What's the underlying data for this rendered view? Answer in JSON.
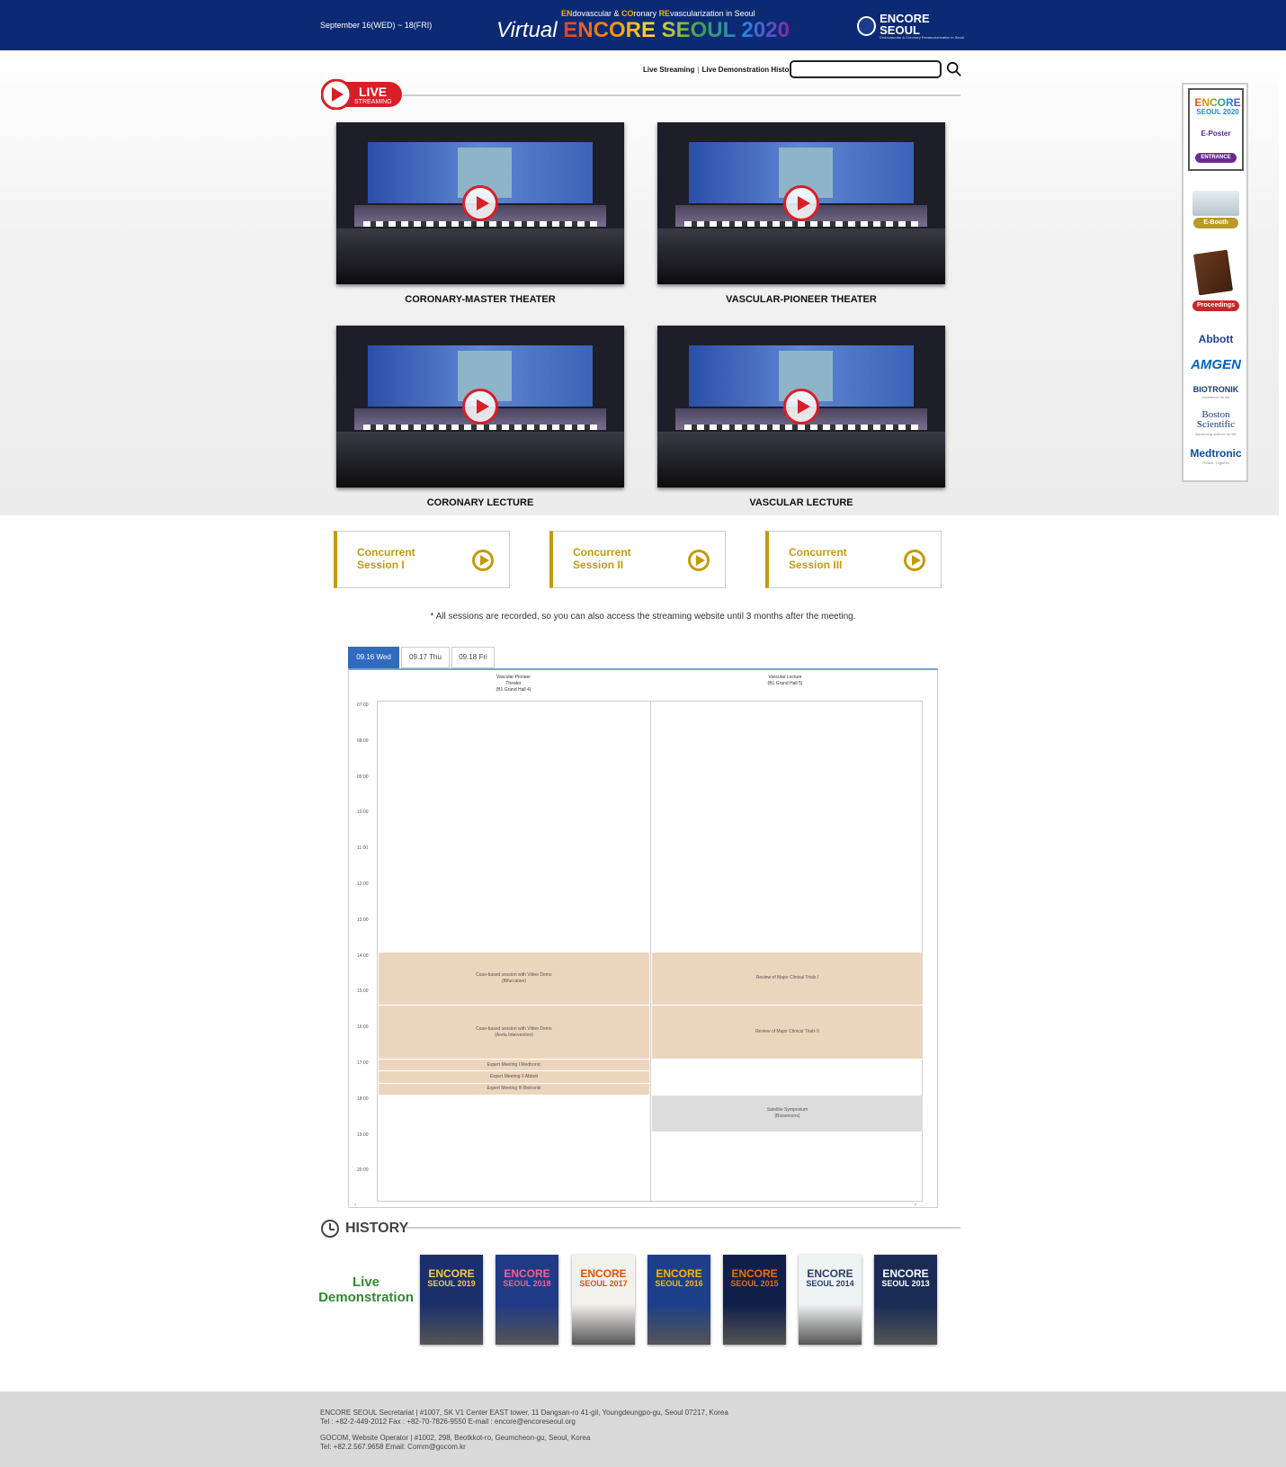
{
  "header": {
    "date": "September 16(WED) ~ 18(FRI)",
    "tag_en": "EN",
    "tag_1": "dovascular & ",
    "tag_co": "CO",
    "tag_2": "ronary ",
    "tag_re": "RE",
    "tag_3": "vascularization in Seoul",
    "title_virtual": "Virtual",
    "title_main": "ENCORE SEOUL 2020",
    "logo_text": "ENCORE SEOUL",
    "logo_sub": "Endovascular & Coronary Revascularization in Seoul"
  },
  "nav": {
    "live_streaming": "Live Streaming",
    "separator": "|",
    "live_demo_history": "Live Demonstration History",
    "search_placeholder": ""
  },
  "live_badge": {
    "live": "LIVE",
    "streaming": "STREAMING"
  },
  "theaters": [
    {
      "label": "CORONARY-MASTER THEATER"
    },
    {
      "label": "VASCULAR-PIONEER THEATER"
    },
    {
      "label": "CORONARY LECTURE"
    },
    {
      "label": "VASCULAR LECTURE"
    }
  ],
  "sidebar": {
    "encore": "ENCORE",
    "seoul2020": "SEOUL 2020",
    "eposter": "E-Poster",
    "entrance": "ENTRANCE",
    "ebooth": "E-Booth",
    "proceedings": "Proceedings",
    "sponsors": [
      {
        "name": "Abbott",
        "sub": "",
        "color": "#1f3f8f"
      },
      {
        "name": "AMGEN",
        "sub": "",
        "color": "#0063c3"
      },
      {
        "name": "BIOTRONIK",
        "sub": "excellence for life",
        "color": "#1a3a7a"
      },
      {
        "name": "Boston Scientific",
        "sub": "Advancing science for life",
        "color": "#1a3a7a"
      },
      {
        "name": "Medtronic",
        "sub": "Further, Together",
        "color": "#0a4fa3"
      }
    ]
  },
  "sessions": [
    {
      "line1": "Concurrent",
      "line2": "Session I"
    },
    {
      "line1": "Concurrent",
      "line2": "Session II"
    },
    {
      "line1": "Concurrent",
      "line2": "Session III"
    }
  ],
  "notice": "* All sessions are recorded, so you can also access the streaming website until 3 months after the meeting.",
  "schedule": {
    "tabs": [
      "09.16 Wed",
      "09.17 Thu",
      "09.18 Fri"
    ],
    "active_tab": "09.16 Wed",
    "columns": [
      {
        "line1": "Vascular-Pioneer",
        "line2": "Theater",
        "line3": "(B1 Grand Hall 4)"
      },
      {
        "line1": "Vascular Lecture",
        "line2": "(B1 Grand Hall 5)",
        "line3": ""
      }
    ],
    "times": [
      "07:00",
      "08:00",
      "09:00",
      "10:00",
      "11:00",
      "12:00",
      "13:00",
      "14:00",
      "15:00",
      "16:00",
      "17:00",
      "18:00",
      "19:00",
      "20:00"
    ],
    "events": [
      {
        "col": 0,
        "start": 14.0,
        "end": 15.5,
        "line1": "Case-based session with Video Demo",
        "line2": "(Bifurcation)",
        "style": "peach"
      },
      {
        "col": 0,
        "start": 15.5,
        "end": 17.0,
        "line1": "Case-based session with Video Demo",
        "line2": "(Aorta Intervention)",
        "style": "peach"
      },
      {
        "col": 0,
        "start": 17.0,
        "end": 17.33,
        "line1": "Expert Meeting I Medtronic",
        "line2": "",
        "style": "peach"
      },
      {
        "col": 0,
        "start": 17.33,
        "end": 17.67,
        "line1": "Expert Meeting II Abbott",
        "line2": "",
        "style": "peach"
      },
      {
        "col": 0,
        "start": 17.67,
        "end": 18.0,
        "line1": "Expert Meeting III Biotronik",
        "line2": "",
        "style": "peach"
      },
      {
        "col": 1,
        "start": 14.0,
        "end": 15.5,
        "line1": "Review of Major Clinical Trials I",
        "line2": "",
        "style": "peach"
      },
      {
        "col": 1,
        "start": 15.5,
        "end": 17.0,
        "line1": "Review of Major Clinical Trials II",
        "line2": "",
        "style": "peach"
      },
      {
        "col": 1,
        "start": 18.0,
        "end": 19.0,
        "line1": "Satellite Symposium",
        "line2": "(Biosensors)",
        "style": "grey"
      }
    ],
    "scroll_left": "‹",
    "scroll_right": "›"
  },
  "history": {
    "title": "HISTORY",
    "live_demo_1": "Live",
    "live_demo_2": "Demonstration",
    "posters": [
      {
        "encore": "ENCORE",
        "year": "SEOUL 2019",
        "bg": "#1b2f6b",
        "fg": "#f7c948"
      },
      {
        "encore": "ENCORE",
        "year": "SEOUL 2018",
        "bg": "#213a86",
        "fg": "#f06292"
      },
      {
        "encore": "ENCORE",
        "year": "SEOUL 2017",
        "bg": "#f3f1ec",
        "fg": "#e65100"
      },
      {
        "encore": "ENCORE",
        "year": "SEOUL 2016",
        "bg": "#1d3f8a",
        "fg": "#ffb300"
      },
      {
        "encore": "ENCORE",
        "year": "SEOUL 2015",
        "bg": "#0f1f4a",
        "fg": "#ef6c00"
      },
      {
        "encore": "ENCORE",
        "year": "SEOUL 2014",
        "bg": "#eef3f3",
        "fg": "#2e3c6e"
      },
      {
        "encore": "ENCORE",
        "year": "SEOUL 2013",
        "bg": "#1a2b55",
        "fg": "#ffffff"
      }
    ]
  },
  "footer": {
    "line1": "ENCORE SEOUL Secretariat | #1007, SK V1 Center EAST tower, 11 Dangsan-ro 41-gil, Youngdeungpo-gu, Seoul 07217, Korea",
    "line2": "Tel : +82-2-449-2012 Fax : +82-70-7826-9550 E-mail : encore@encoreseoul.org",
    "line3": "GOCOM, Website Operator | #1002, 298, Beotkkot-ro, Geumcheon-gu, Seoul, Korea",
    "line4": "Tel: +82.2.567.9658 Email: Comm@gocom.kr"
  }
}
